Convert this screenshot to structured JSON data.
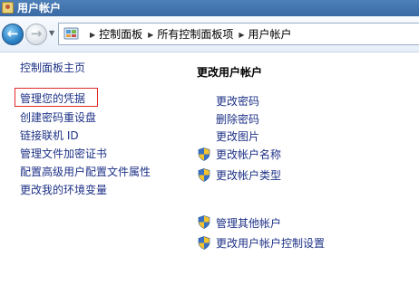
{
  "window": {
    "title": "用户帐户"
  },
  "navigation": {
    "back_icon": "back-arrow-icon",
    "forward_icon": "forward-arrow-icon",
    "history_icon": "chevron-down-icon",
    "breadcrumbs": [
      "控制面板",
      "所有控制面板项",
      "用户帐户"
    ]
  },
  "sidebar": {
    "items": [
      {
        "label": "控制面板主页"
      },
      {
        "label": "管理您的凭据"
      },
      {
        "label": "创建密码重设盘"
      },
      {
        "label": "链接联机 ID"
      },
      {
        "label": "管理文件加密证书"
      },
      {
        "label": "配置高级用户配置文件属性"
      },
      {
        "label": "更改我的环境变量"
      }
    ],
    "highlighted_item": "管理您的凭据",
    "highlight_color": "#e12a2a"
  },
  "main": {
    "heading": "更改用户帐户",
    "links": [
      {
        "label": "更改密码",
        "icon": ""
      },
      {
        "label": "删除密码",
        "icon": ""
      },
      {
        "label": "更改图片",
        "icon": ""
      },
      {
        "label": "更改帐户名称",
        "icon": "uac-shield-icon"
      },
      {
        "label": "更改帐户类型",
        "icon": "uac-shield-icon"
      }
    ],
    "other_links": [
      {
        "label": "管理其他帐户",
        "icon": "uac-shield-icon"
      },
      {
        "label": "更改用户帐户控制设置",
        "icon": "uac-shield-icon"
      }
    ]
  },
  "colors": {
    "link": "#1e3287",
    "title_bar": "#3a6aa3",
    "heading": "#000000"
  }
}
